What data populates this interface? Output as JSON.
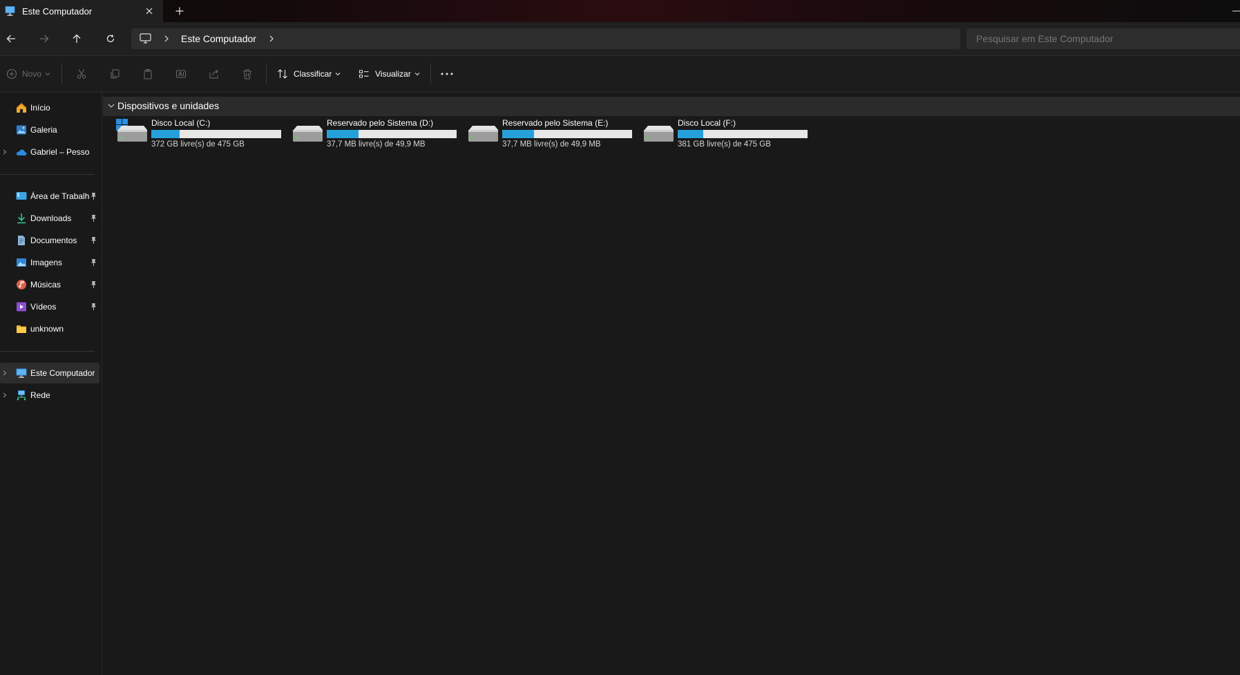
{
  "window": {
    "tab_title": "Este Computador",
    "tab_icon": "computer-icon"
  },
  "address_bar": {
    "location_icon": "computer-icon",
    "path": "Este Computador",
    "search_placeholder": "Pesquisar em Este Computador"
  },
  "toolbar": {
    "new_label": "Novo",
    "sort_label": "Classificar",
    "view_label": "Visualizar"
  },
  "sidebar": {
    "top": [
      {
        "label": "Início",
        "icon": "home-icon"
      },
      {
        "label": "Galeria",
        "icon": "gallery-icon"
      },
      {
        "label": "Gabriel – Pessoal",
        "icon": "onedrive-cloud-icon"
      }
    ],
    "pinned": [
      {
        "label": "Área de Trabalho",
        "icon": "desktop-icon",
        "pinned": true
      },
      {
        "label": "Downloads",
        "icon": "download-icon",
        "pinned": true
      },
      {
        "label": "Documentos",
        "icon": "document-icon",
        "pinned": true
      },
      {
        "label": "Imagens",
        "icon": "pictures-icon",
        "pinned": true
      },
      {
        "label": "Músicas",
        "icon": "music-icon",
        "pinned": true
      },
      {
        "label": "Vídeos",
        "icon": "video-icon",
        "pinned": true
      },
      {
        "label": "unknown",
        "icon": "folder-icon",
        "pinned": false
      }
    ],
    "bottom": [
      {
        "label": "Este Computador",
        "icon": "computer-icon",
        "selected": true
      },
      {
        "label": "Rede",
        "icon": "network-icon"
      }
    ]
  },
  "main": {
    "group_title": "Dispositivos e unidades",
    "drives": [
      {
        "name": "Disco Local (C:)",
        "free_text": "372 GB livre(s) de 475 GB",
        "used_fraction": 0.217,
        "system": true
      },
      {
        "name": "Reservado pelo Sistema (D:)",
        "free_text": "37,7 MB livre(s) de 49,9 MB",
        "used_fraction": 0.245,
        "system": false
      },
      {
        "name": "Reservado pelo Sistema (E:)",
        "free_text": "37,7 MB livre(s) de 49,9 MB",
        "used_fraction": 0.245,
        "system": false
      },
      {
        "name": "Disco Local (F:)",
        "free_text": "381 GB livre(s) de 475 GB",
        "used_fraction": 0.198,
        "system": false
      }
    ]
  },
  "colors": {
    "accent": "#26a0da",
    "background": "#191919",
    "bar_track": "#e6e6e6"
  }
}
